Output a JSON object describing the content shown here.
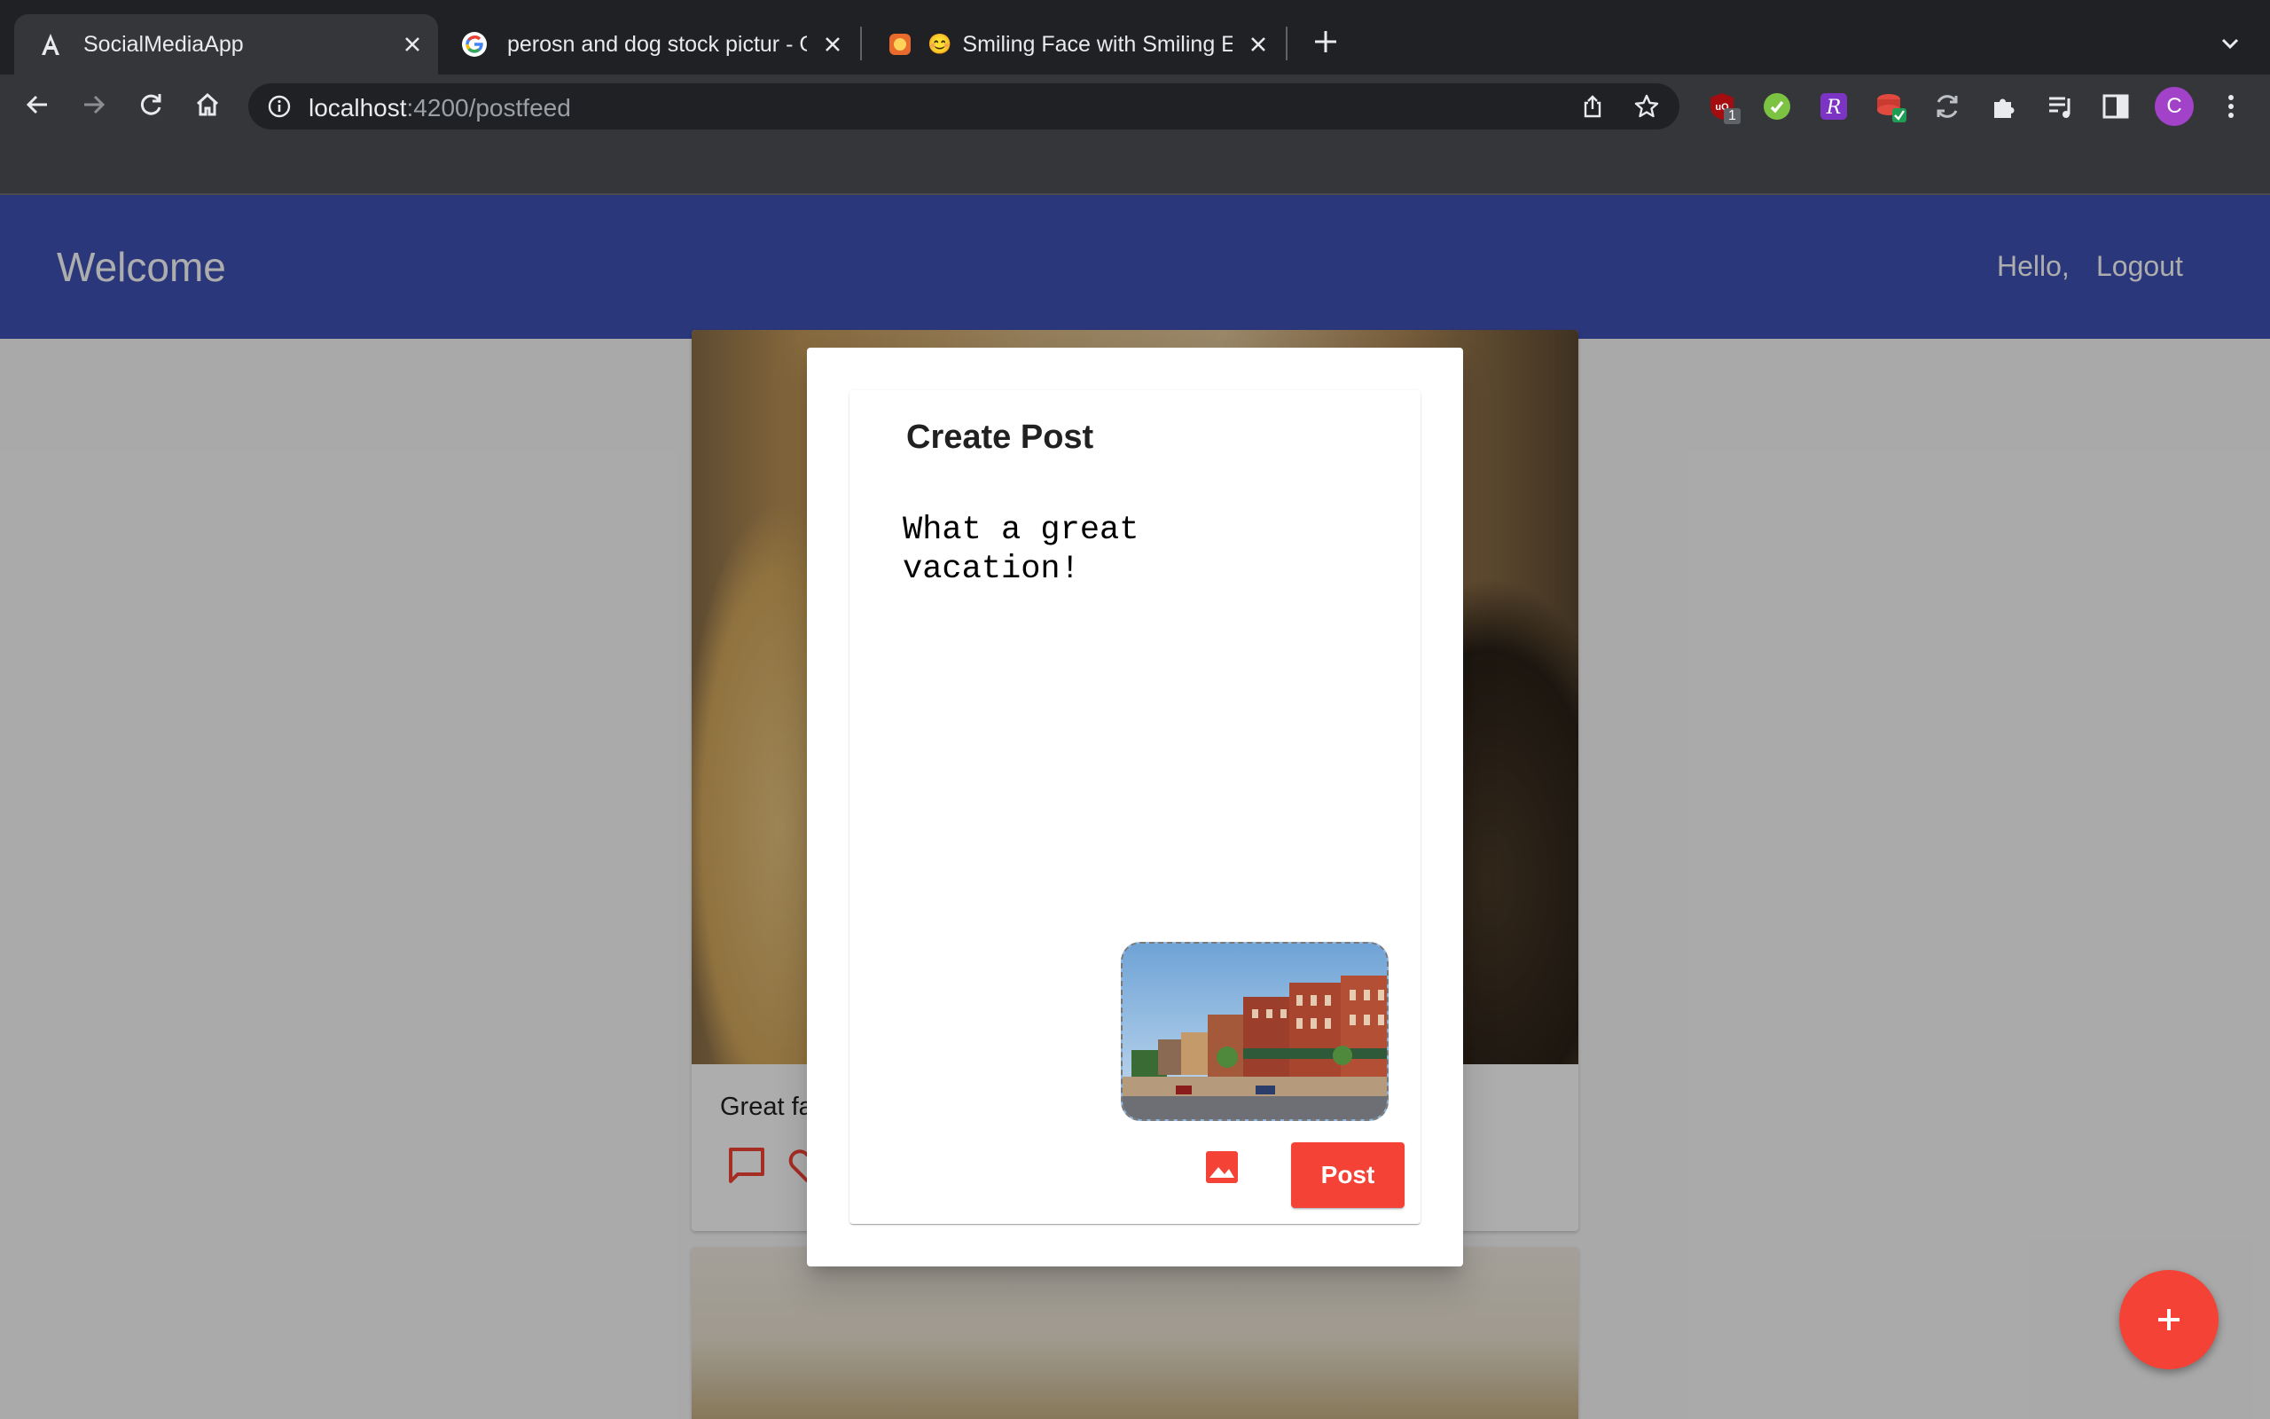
{
  "browser": {
    "tabs": [
      {
        "title": "SocialMediaApp",
        "favicon": "angular-icon",
        "active": true
      },
      {
        "title": "perosn and dog stock pictur - Google Search",
        "favicon": "google-icon",
        "active": false
      },
      {
        "title": "Smiling Face with Smiling Eyes Emoji",
        "favicon": "emojipedia-icon",
        "emoji": "😊",
        "active": false
      }
    ],
    "omnibox": {
      "host": "localhost",
      "path": ":4200/postfeed"
    },
    "profile_initial": "C",
    "extension_badge": "1"
  },
  "app": {
    "title": "Welcome",
    "greeting": "Hello,",
    "logout_label": "Logout",
    "primary_color": "#3f51b5",
    "accent_color": "#f44336"
  },
  "feed": {
    "posts": [
      {
        "caption": "Great fa",
        "actions": [
          "comment-icon",
          "heart-icon"
        ]
      }
    ]
  },
  "dialog": {
    "title": "Create Post",
    "text_value": "What a great\nvacation!",
    "image_attached": "main-street-photo",
    "post_label": "Post",
    "image_button_icon": "image-icon"
  },
  "fab": {
    "icon": "plus-icon"
  }
}
